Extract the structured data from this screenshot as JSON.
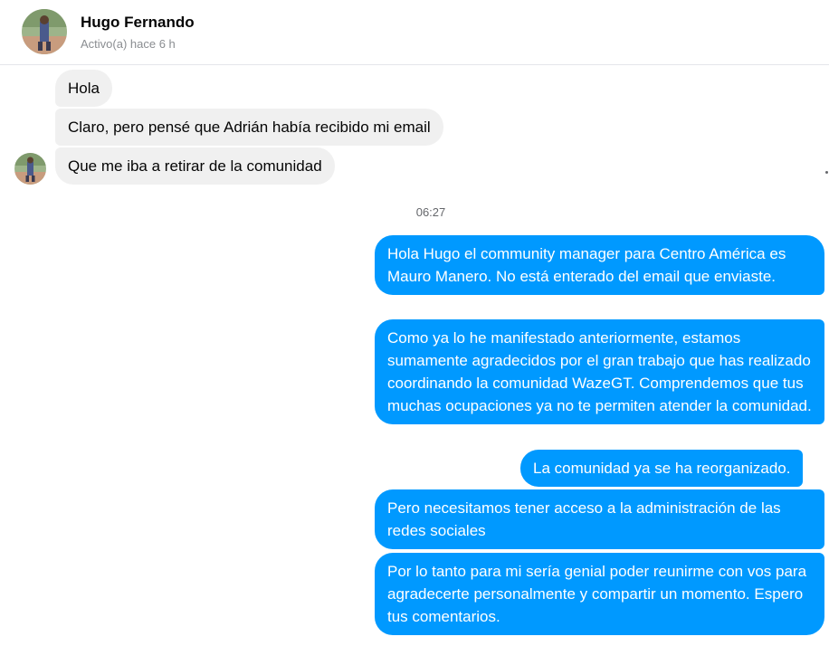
{
  "header": {
    "name": "Hugo Fernando",
    "status": "Activo(a) hace 6 h"
  },
  "contact_avatar_icon": "user-avatar-icon",
  "colors": {
    "outgoing_bubble": "#0099ff",
    "incoming_bubble": "#f0f0f0"
  },
  "messages": {
    "incoming": [
      "Hola",
      "Claro, pero pensé que Adrián había recibido mi email",
      "Que me iba a retirar de la comunidad"
    ],
    "timestamp": "06:27",
    "outgoing": [
      "Hola Hugo el community manager para Centro América es Mauro Manero. No está enterado del email que enviaste.",
      "Como ya lo he manifestado anteriormente, estamos sumamente agradecidos por el gran trabajo que has realizado coordinando la comunidad WazeGT. Comprendemos que tus muchas ocupaciones ya no te permiten atender la comunidad.",
      "La comunidad ya se ha reorganizado.",
      "Pero necesitamos tener acceso a la administración de las redes sociales",
      "Por lo tanto para mi sería genial poder reunirme con vos para agradecerte personalmente y compartir un momento. Espero tus comentarios."
    ]
  }
}
